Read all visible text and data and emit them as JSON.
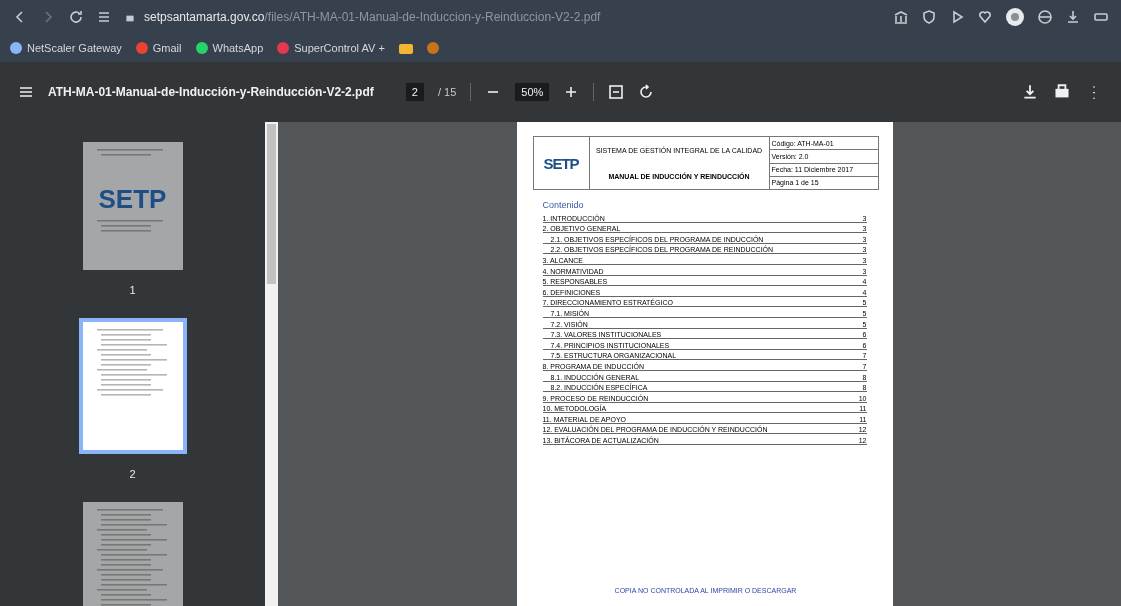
{
  "browser": {
    "url_host": "setpsantamarta.gov.co",
    "url_path": "/files/ATH-MA-01-Manual-de-Induccion-y-Reinduccion-V2-2.pdf",
    "bookmarks": [
      {
        "label": "NetScaler Gateway",
        "color": "#8ab4f8"
      },
      {
        "label": "Gmail",
        "color": "#ea4335"
      },
      {
        "label": "WhatsApp",
        "color": "#25d366"
      },
      {
        "label": "SuperControl AV +",
        "color": "#e53950"
      }
    ]
  },
  "pdf_toolbar": {
    "title": "ATH-MA-01-Manual-de-Inducción-y-Reinducción-V2-2.pdf",
    "page_current": "2",
    "page_total": "/ 15",
    "zoom": "50%"
  },
  "thumbnails": [
    {
      "kind": "cover",
      "cover_text": "SETP",
      "label": "1",
      "selected": false
    },
    {
      "kind": "contents",
      "label": "2",
      "selected": true
    },
    {
      "kind": "text",
      "selected": false
    }
  ],
  "document": {
    "logo": "SETP",
    "system_title": "SISTEMA DE GESTIÓN INTEGRAL DE LA CALIDAD",
    "manual_title": "MANUAL DE INDUCCIÓN Y REINDUCCIÓN",
    "meta": [
      "Código: ATH-MA-01",
      "Versión: 2.0",
      "Fecha: 11 Diciembre 2017",
      "Página 1 de 15"
    ],
    "toc_heading": "Contenido",
    "toc": [
      {
        "title": "1. INTRODUCCIÓN",
        "page": "3"
      },
      {
        "title": "2. OBJETIVO GENERAL",
        "page": "3",
        "children": [
          {
            "title": "2.1. OBJETIVOS ESPECÍFICOS DEL PROGRAMA DE INDUCCIÓN",
            "page": "3"
          },
          {
            "title": "2.2. OBJETIVOS ESPECÍFICOS DEL PROGRAMA DE REINDUCCIÓN",
            "page": "3"
          }
        ]
      },
      {
        "title": "3. ALCANCE",
        "page": "3"
      },
      {
        "title": "4. NORMATIVIDAD",
        "page": "3"
      },
      {
        "title": "5. RESPONSABLES",
        "page": "4"
      },
      {
        "title": "6. DEFINICIONES",
        "page": "4"
      },
      {
        "title": "7. DIRECCIONAMIENTO ESTRATÉGICO",
        "page": "5",
        "children": [
          {
            "title": "7.1. MISIÓN",
            "page": "5"
          },
          {
            "title": "7.2. VISIÓN",
            "page": "5"
          },
          {
            "title": "7.3. VALORES INSTITUCIONALES",
            "page": "6"
          },
          {
            "title": "7.4. PRINCIPIOS INSTITUCIONALES",
            "page": "6"
          },
          {
            "title": "7.5. ESTRUCTURA ORGANIZACIONAL",
            "page": "7"
          }
        ]
      },
      {
        "title": "8. PROGRAMA DE INDUCCIÓN",
        "page": "7",
        "children": [
          {
            "title": "8.1. INDUCCIÓN GENERAL",
            "page": "8"
          },
          {
            "title": "8.2. INDUCCIÓN ESPECÍFICA",
            "page": "8"
          }
        ]
      },
      {
        "title": "9. PROCESO DE REINDUCCIÓN",
        "page": "10"
      },
      {
        "title": "10. METODOLOGÍA",
        "page": "11"
      },
      {
        "title": "11. MATERIAL DE APOYO",
        "page": "11"
      },
      {
        "title": "12. EVALUACIÓN DEL PROGRAMA DE INDUCCIÓN Y REINDUCCIÓN",
        "page": "12"
      },
      {
        "title": "13. BITÁCORA DE ACTUALIZACIÓN",
        "page": "12"
      }
    ],
    "footer": "COPIA NO CONTROLADA AL IMPRIMIR O DESCARGAR"
  }
}
